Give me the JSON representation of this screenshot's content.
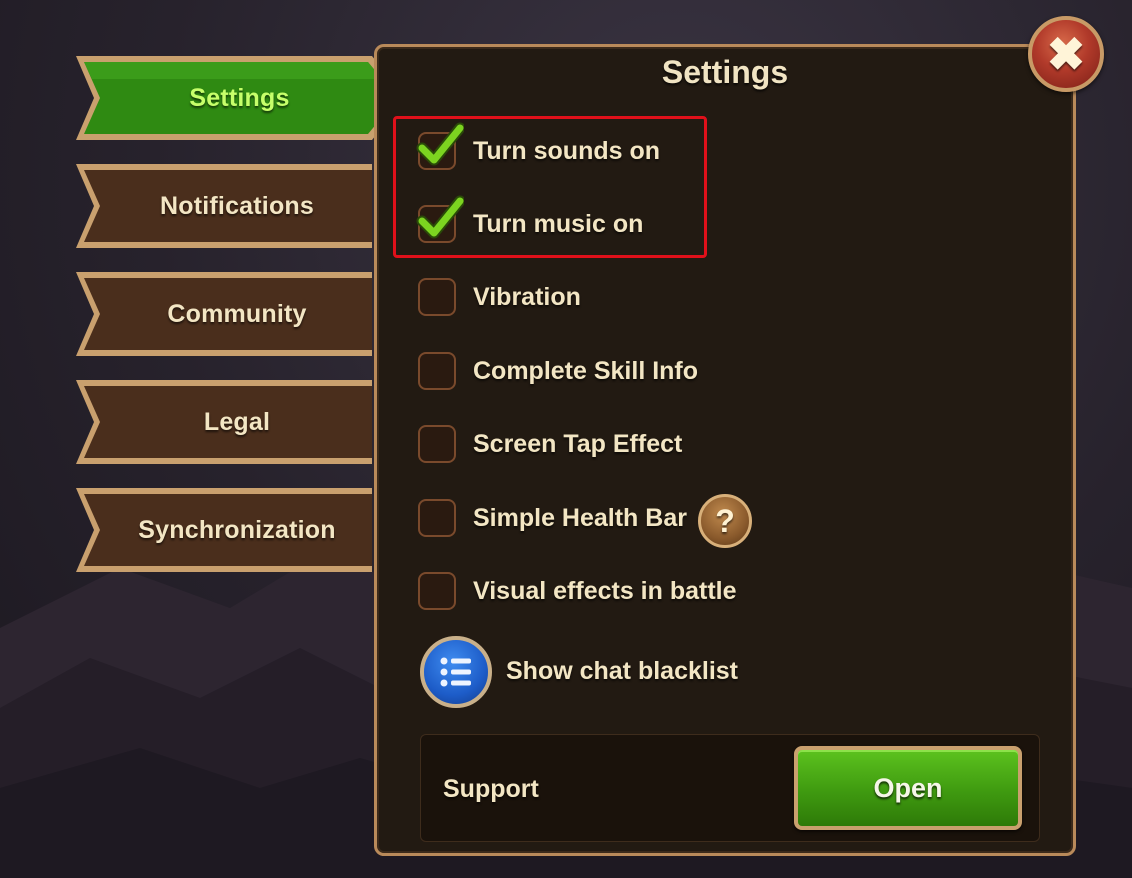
{
  "tabs": [
    {
      "label": "Settings",
      "active": true
    },
    {
      "label": "Notifications",
      "active": false
    },
    {
      "label": "Community",
      "active": false
    },
    {
      "label": "Legal",
      "active": false
    },
    {
      "label": "Synchronization",
      "active": false
    }
  ],
  "panel": {
    "title": "Settings"
  },
  "options": [
    {
      "label": "Turn sounds on",
      "checked": true
    },
    {
      "label": "Turn music on",
      "checked": true
    },
    {
      "label": "Vibration",
      "checked": false
    },
    {
      "label": "Complete Skill Info",
      "checked": false
    },
    {
      "label": "Screen Tap Effect",
      "checked": false
    },
    {
      "label": "Simple Health Bar",
      "checked": false
    },
    {
      "label": "Visual effects in battle",
      "checked": false
    }
  ],
  "help_button": {
    "label": "?"
  },
  "chat_blacklist": {
    "label": "Show chat blacklist",
    "icon": "list-icon"
  },
  "support": {
    "label": "Support",
    "button_label": "Open"
  },
  "close_button": {
    "icon": "close-icon",
    "glyph": "✖"
  },
  "colors": {
    "panel_bg": "#221a12",
    "panel_border": "#b98a5a",
    "text": "#f3e6c4",
    "active_tab": "#2f8a12",
    "active_tab_text": "#c6ff6a",
    "checkmark": "#7cd420",
    "highlight": "#e0101a",
    "open_button": "#3f9a10"
  }
}
